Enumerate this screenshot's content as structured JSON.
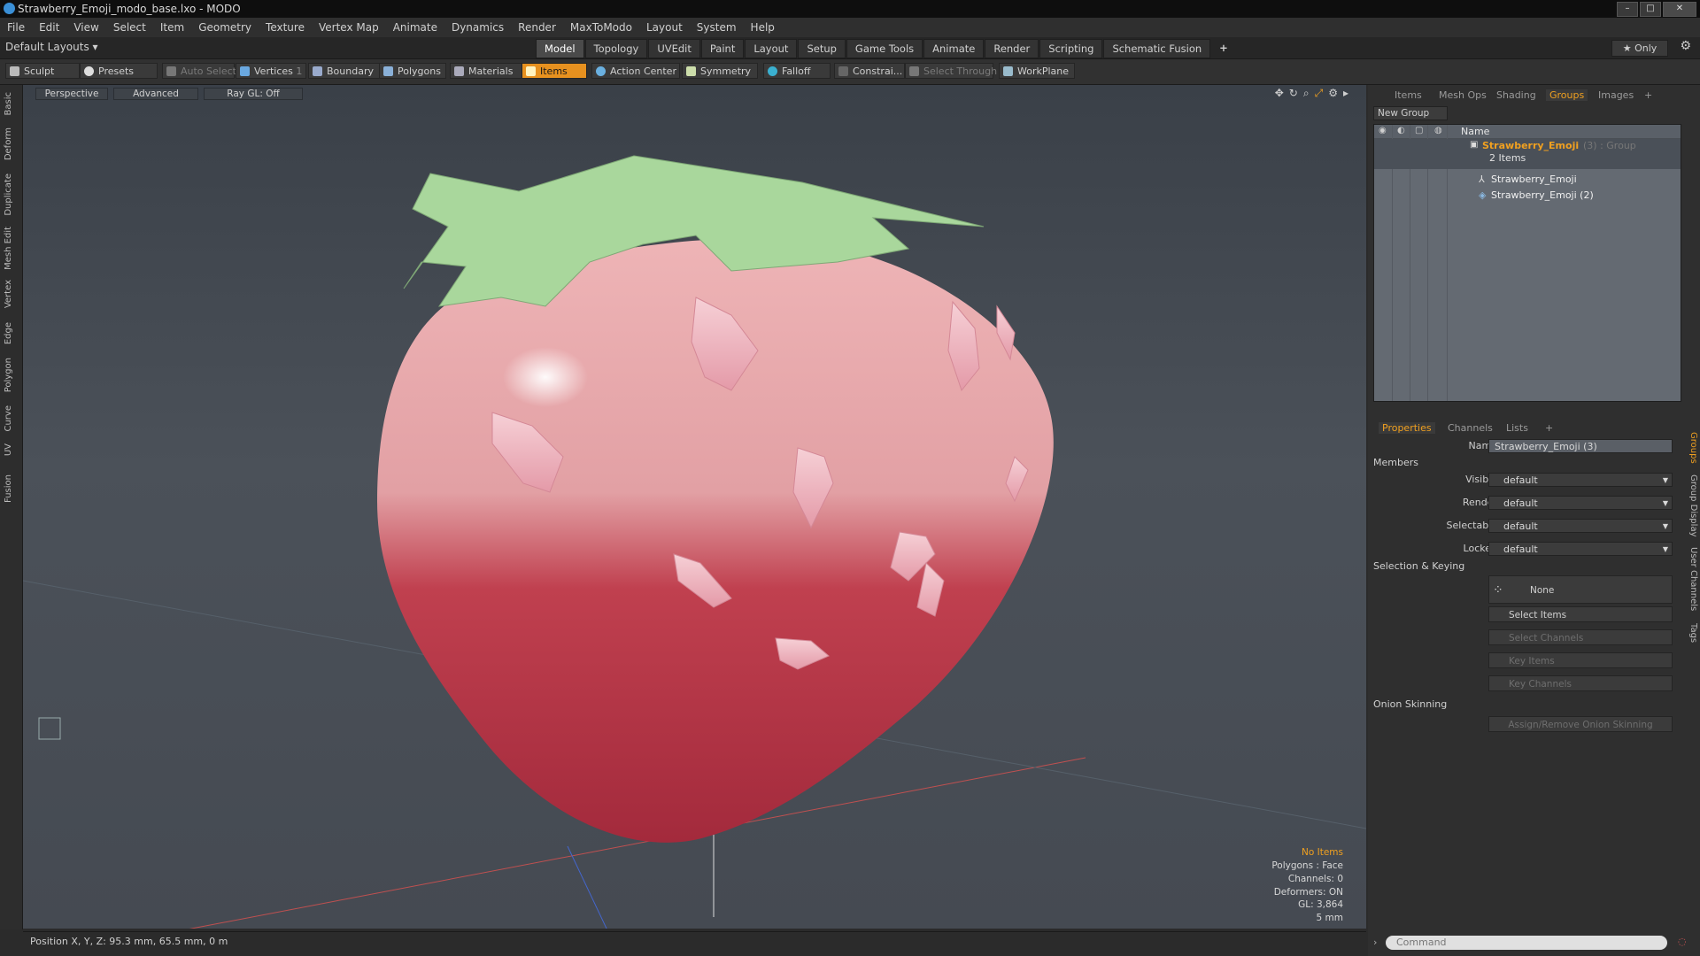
{
  "window": {
    "title": "Strawberry_Emoji_modo_base.lxo - MODO",
    "controls": [
      "–",
      "□",
      "✕"
    ]
  },
  "menu": [
    "File",
    "Edit",
    "View",
    "Select",
    "Item",
    "Geometry",
    "Texture",
    "Vertex Map",
    "Animate",
    "Dynamics",
    "Render",
    "MaxToModo",
    "Layout",
    "System",
    "Help"
  ],
  "layouts_label": "Default Layouts ▾",
  "context_tabs": [
    "Model",
    "Topology",
    "UVEdit",
    "Paint",
    "Layout",
    "Setup",
    "Game Tools",
    "Animate",
    "Render",
    "Scripting",
    "Schematic Fusion",
    "+"
  ],
  "active_context_tab": "Model",
  "only_label": "★ Only",
  "toolbar": {
    "sculpt": "Sculpt",
    "presets": "Presets",
    "auto_select": "Auto Select",
    "vertices": "Vertices",
    "boundary": "Boundary",
    "polygons": "Polygons",
    "materials": "Materials",
    "items": "Items",
    "action_center": "Action Center",
    "symmetry": "Symmetry",
    "falloff": "Falloff",
    "constraints": "Constrai...",
    "select_through": "Select Through",
    "workplane": "WorkPlane",
    "vertices_count": "1"
  },
  "left_tabs": [
    "Basic",
    "Deform",
    "Duplicate",
    "Mesh Edit",
    "Vertex",
    "Edge",
    "Polygon",
    "Curve",
    "UV",
    "Fusion"
  ],
  "viewport": {
    "perspective": "Perspective",
    "advanced": "Advanced",
    "raygl": "Ray GL: Off",
    "info": {
      "no_items": "No Items",
      "polygons": "Polygons : Face",
      "channels": "Channels: 0",
      "deformers": "Deformers: ON",
      "gl": "GL: 3,864",
      "unit": "5 mm"
    }
  },
  "status": {
    "position": "Position X, Y, Z:  95.3 mm, 65.5 mm, 0 m"
  },
  "panel_tabs": [
    "Items",
    "Mesh Ops",
    "Shading",
    "Groups",
    "Images",
    "+"
  ],
  "active_panel_tab": "Groups",
  "groups": {
    "new_group": "New Group",
    "header_name": "Name",
    "group_name": "Strawberry_Emoji",
    "group_suffix": "(3) : Group",
    "group_count": "2 Items",
    "children": [
      "Strawberry_Emoji",
      "Strawberry_Emoji (2)"
    ]
  },
  "props_tabs": [
    "Properties",
    "Channels",
    "Lists",
    "+"
  ],
  "props": {
    "name_label": "Name",
    "name_value": "Strawberry_Emoji (3)",
    "members": "Members",
    "visible_label": "Visible",
    "visible_value": "default",
    "render_label": "Render",
    "render_value": "default",
    "selectable_label": "Selectable",
    "selectable_value": "default",
    "locked_label": "Locked",
    "locked_value": "default",
    "selection_keying": "Selection & Keying",
    "none_btn": "None",
    "select_items": "Select Items",
    "select_channels": "Select Channels",
    "key_items": "Key Items",
    "key_channels": "Key Channels",
    "onion": "Onion Skinning",
    "assign_onion": "Assign/Remove Onion Skinning"
  },
  "right_vtabs": [
    "Groups",
    "Group Display",
    "User Channels",
    "Tags"
  ],
  "command": {
    "placeholder": "Command"
  },
  "colors": {
    "accent": "#f0a020",
    "strawberry_top": "#e8a6a8",
    "strawberry_bottom": "#b83446",
    "leaf": "#a9d79c"
  }
}
